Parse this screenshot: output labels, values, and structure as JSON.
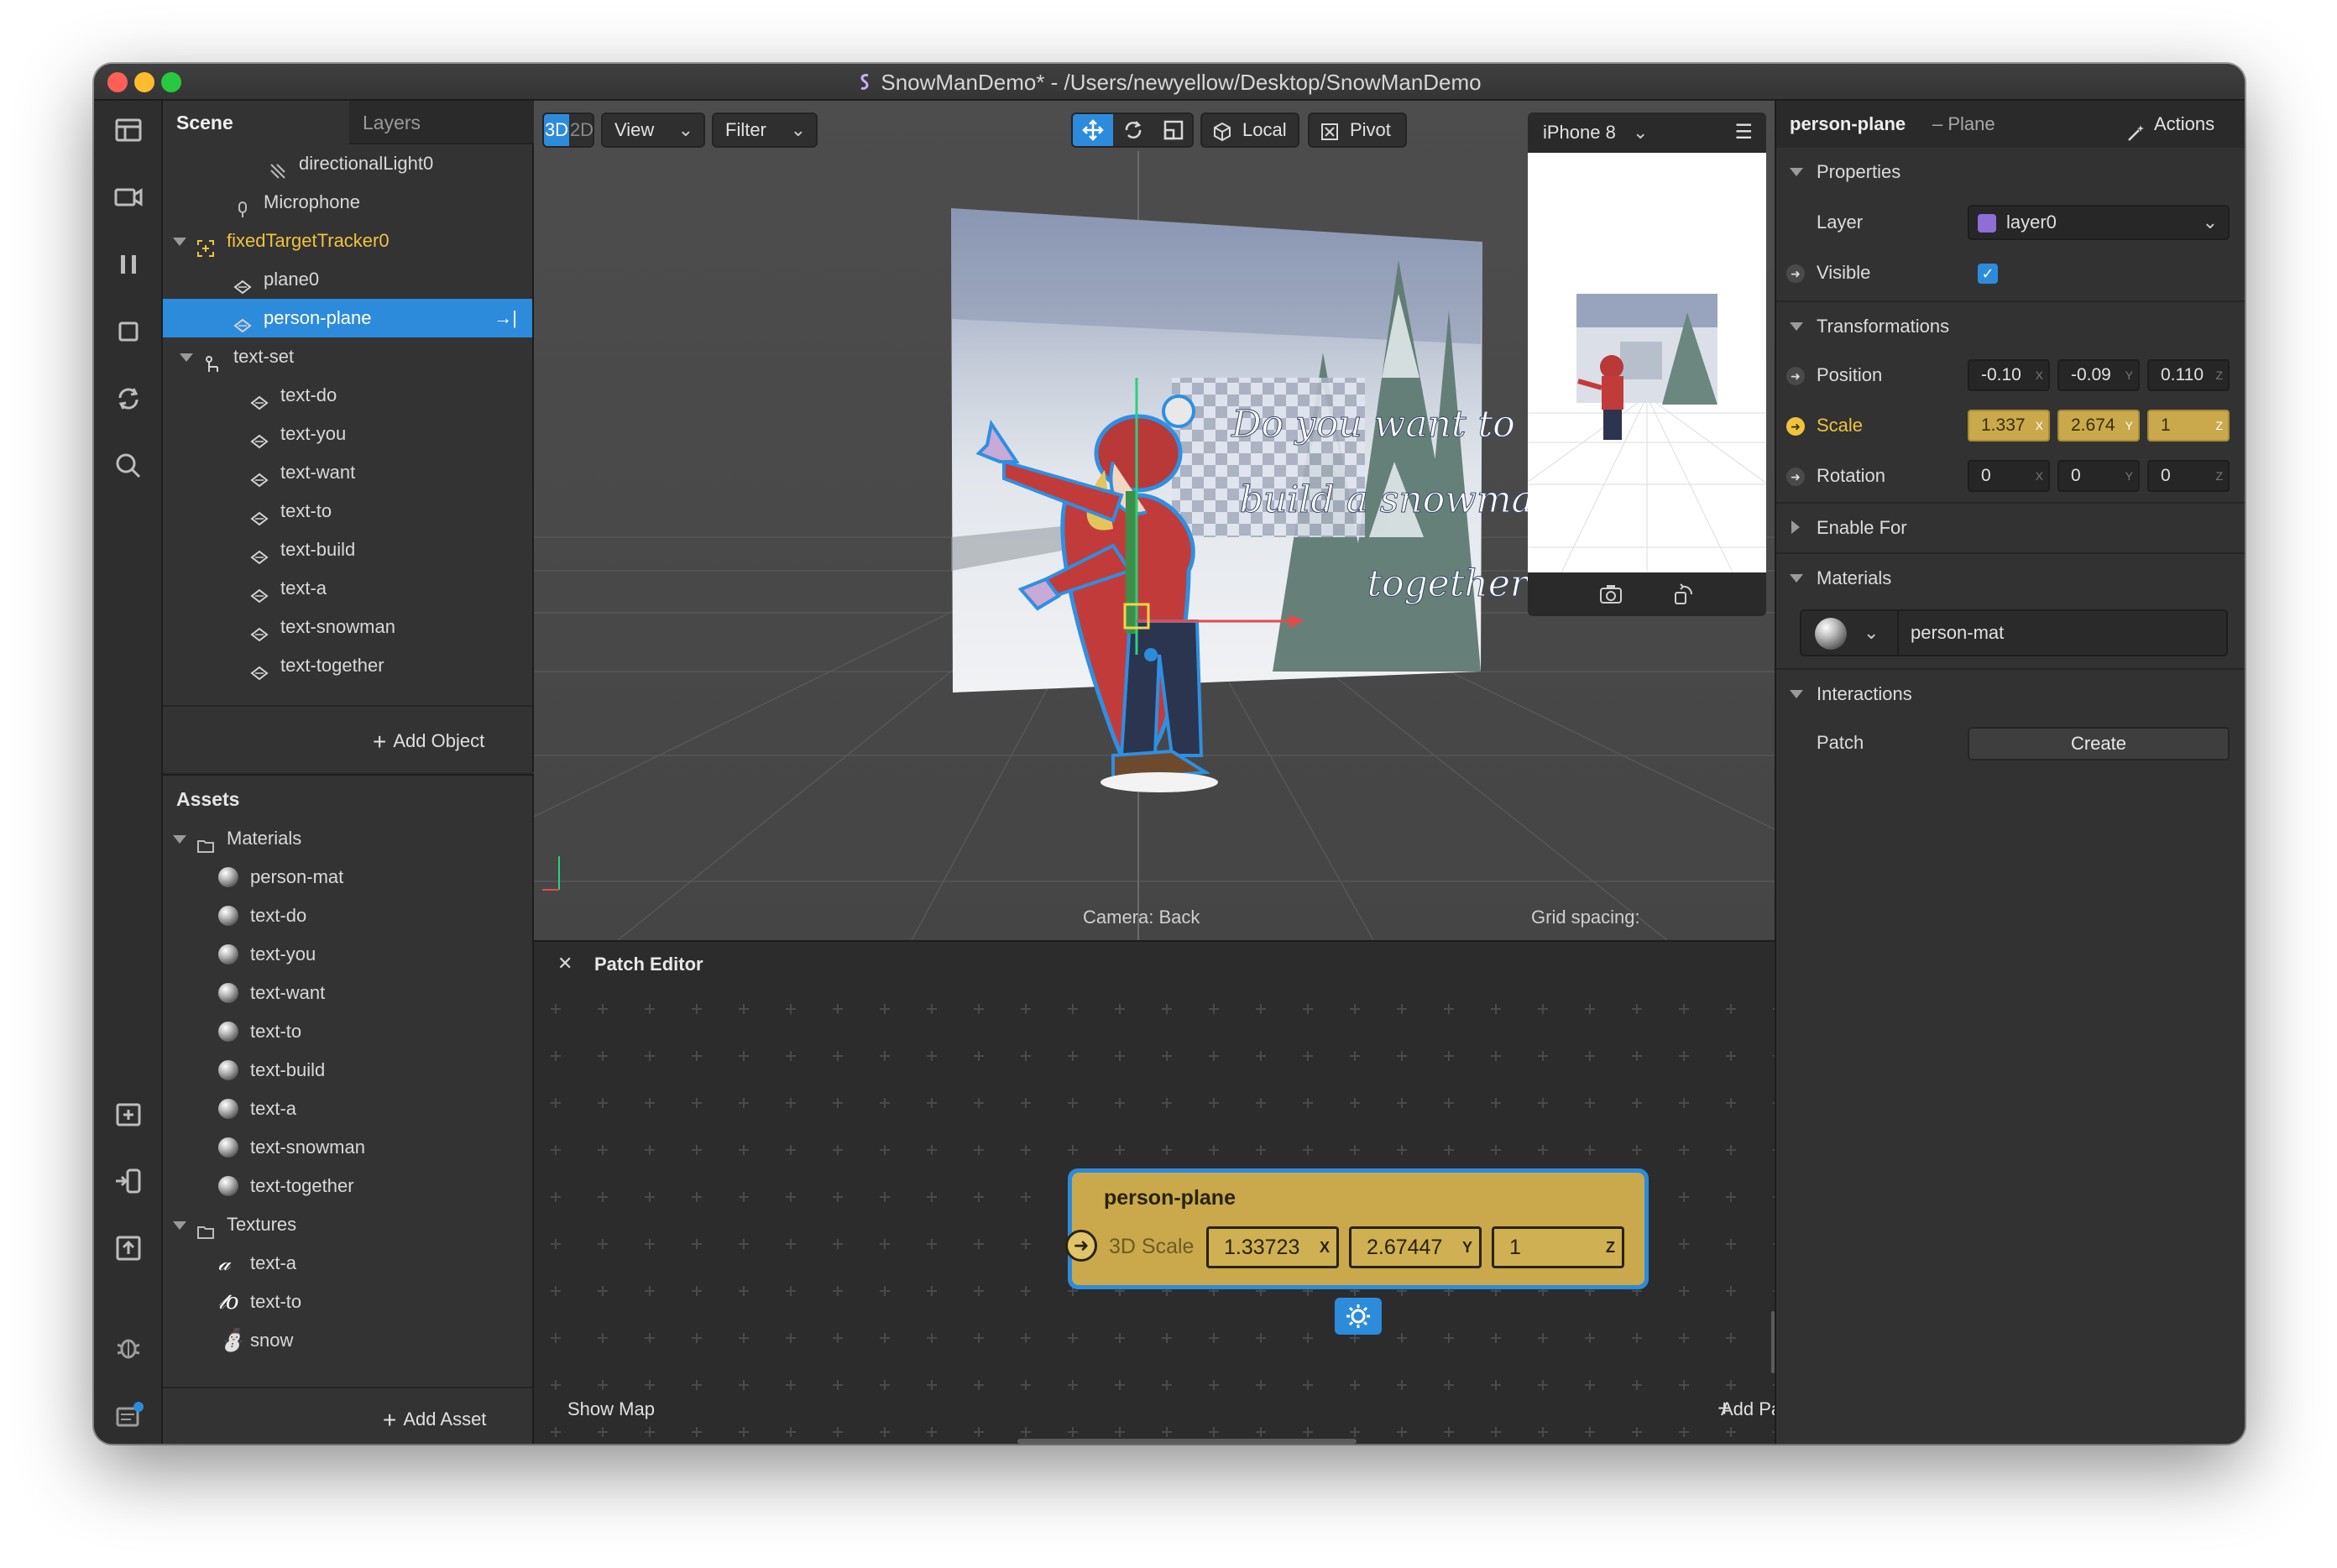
{
  "window": {
    "title": "SnowManDemo* - /Users/newyellow/Desktop/SnowManDemo"
  },
  "scene_panel": {
    "tabs": [
      "Scene",
      "Layers"
    ],
    "tree": [
      {
        "label": "directionalLight0",
        "icon": "light-icon"
      },
      {
        "label": "Microphone",
        "icon": "microphone-icon"
      },
      {
        "label": "fixedTargetTracker0",
        "icon": "tracker-icon"
      },
      {
        "label": "plane0",
        "icon": "plane-icon"
      },
      {
        "label": "person-plane",
        "icon": "plane-icon"
      },
      {
        "label": "text-set",
        "icon": "null-object-icon"
      },
      {
        "label": "text-do",
        "icon": "plane-icon"
      },
      {
        "label": "text-you",
        "icon": "plane-icon"
      },
      {
        "label": "text-want",
        "icon": "plane-icon"
      },
      {
        "label": "text-to",
        "icon": "plane-icon"
      },
      {
        "label": "text-build",
        "icon": "plane-icon"
      },
      {
        "label": "text-a",
        "icon": "plane-icon"
      },
      {
        "label": "text-snowman",
        "icon": "plane-icon"
      },
      {
        "label": "text-together",
        "icon": "plane-icon"
      }
    ],
    "add_object": "Add Object"
  },
  "assets_panel": {
    "title": "Assets",
    "materials_folder": "Materials",
    "materials": [
      "person-mat",
      "text-do",
      "text-you",
      "text-want",
      "text-to",
      "text-build",
      "text-a",
      "text-snowman",
      "text-together"
    ],
    "textures_folder": "Textures",
    "textures": [
      "text-a",
      "text-to",
      "snow"
    ],
    "add_asset": "Add Asset"
  },
  "viewport": {
    "mode_3d": "3D",
    "mode_2d": "2D",
    "view": "View",
    "filter": "Filter",
    "local": "Local",
    "pivot": "Pivot",
    "device": "iPhone 8",
    "camera": "Camera: Back",
    "grid": "Grid spacing:",
    "scene_text": [
      "Do you want to",
      "build a snowman",
      "together?"
    ]
  },
  "patch_editor": {
    "title": "Patch Editor",
    "node_title": "person-plane",
    "port_label": "3D Scale",
    "x": "1.33723",
    "y": "2.67447",
    "z": "1",
    "show_map": "Show Map",
    "add_patch": "Add Patch"
  },
  "inspector": {
    "object_name": "person-plane",
    "object_type": "– Plane",
    "actions": "Actions",
    "properties": "Properties",
    "layer_label": "Layer",
    "layer_value": "layer0",
    "visible_label": "Visible",
    "transformations": "Transformations",
    "position_label": "Position",
    "position": [
      "-0.10",
      "-0.09",
      "0.110"
    ],
    "scale_label": "Scale",
    "scale": [
      "1.337",
      "2.674",
      "1"
    ],
    "rotation_label": "Rotation",
    "rotation": [
      "0",
      "0",
      "0"
    ],
    "enable_for": "Enable For",
    "materials": "Materials",
    "material_value": "person-mat",
    "interactions": "Interactions",
    "patch_label": "Patch",
    "create": "Create"
  },
  "axes": {
    "x": "X",
    "y": "Y",
    "z": "Z"
  },
  "colors": {
    "accent": "#2d8bdc",
    "patch_node": "#c9a94c",
    "scale_highlight": "#f0c33c"
  }
}
